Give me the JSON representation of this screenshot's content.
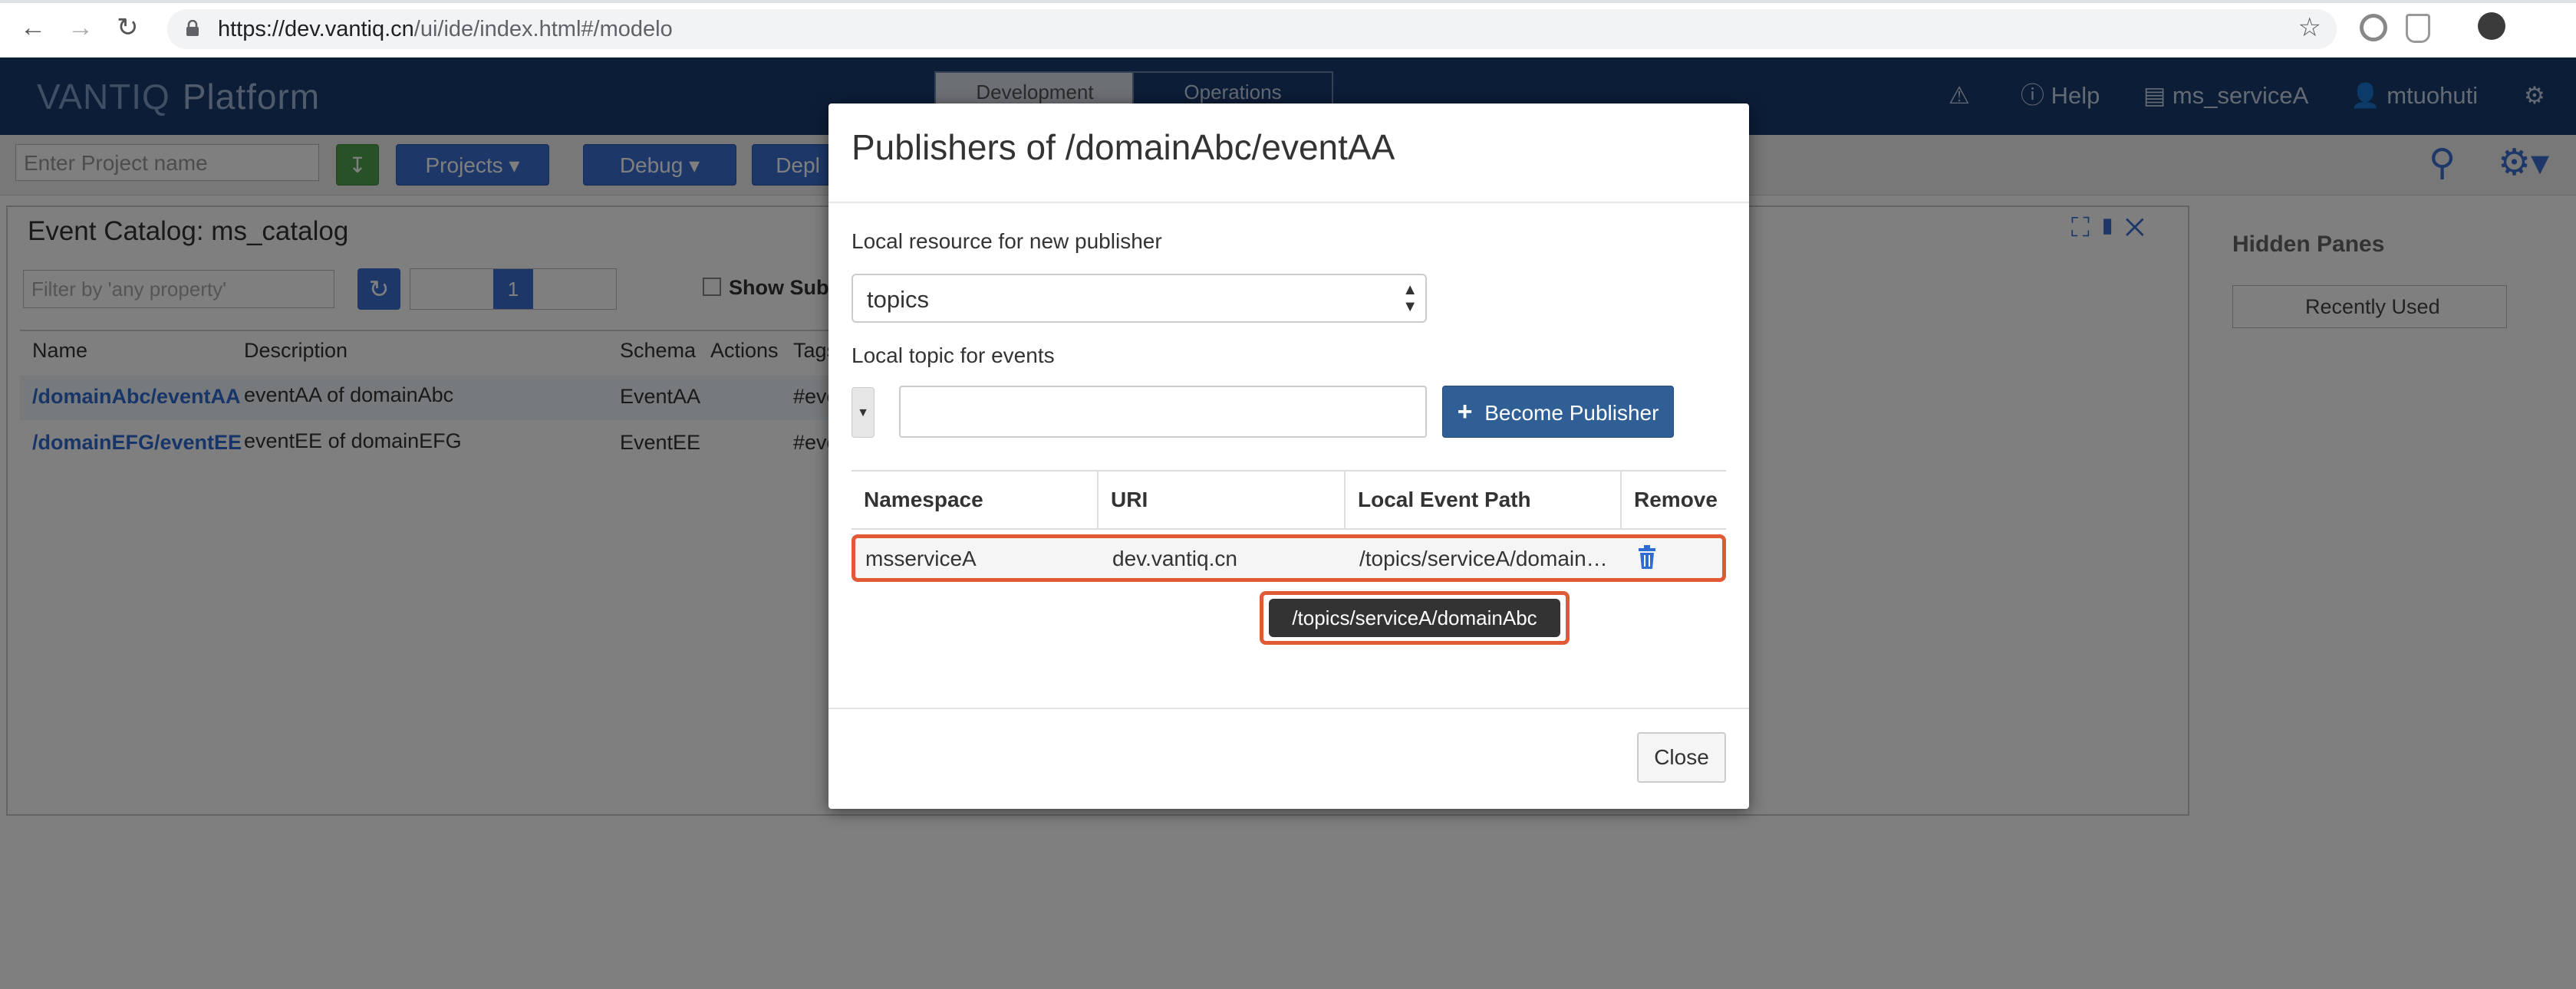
{
  "browser": {
    "url_host": "https://dev.vantiq.cn",
    "url_path": "/ui/ide/index.html#/modelo"
  },
  "app": {
    "logo": "VANTIQ",
    "platform": "Platform",
    "mode_tabs": [
      "Development",
      "Operations"
    ],
    "help": "Help",
    "namespace": "ms_serviceA",
    "user": "mtuohuti"
  },
  "toolbar": {
    "project_placeholder": "Enter Project name",
    "projects": "Projects",
    "debug": "Debug",
    "deploy": "Depl"
  },
  "panel": {
    "title": "Event Catalog: ms_catalog",
    "filter_placeholder": "Filter by 'any property'",
    "page": "1",
    "show_subs": "Show Subs",
    "columns": [
      "Name",
      "Description",
      "Schema",
      "Actions",
      "Tags"
    ],
    "rows": [
      {
        "name": "/domainAbc/eventAA",
        "description": "eventAA of domainAbc",
        "schema": "EventAA",
        "tags": "#eve"
      },
      {
        "name": "/domainEFG/eventEE",
        "description": "eventEE of domainEFG",
        "schema": "EventEE",
        "tags": "#eve"
      }
    ]
  },
  "right_pane": {
    "title": "Hidden Panes",
    "sort": "Recently Used"
  },
  "modal": {
    "title": "Publishers of /domainAbc/eventAA",
    "resource_label": "Local resource for new publisher",
    "resource_value": "topics",
    "topic_label": "Local topic for events",
    "become_publisher": "Become Publisher",
    "columns": [
      "Namespace",
      "URI",
      "Local Event Path",
      "Remove"
    ],
    "row": {
      "namespace": "msserviceA",
      "uri": "dev.vantiq.cn",
      "path": "/topics/serviceA/domain…"
    },
    "tooltip": "/topics/serviceA/domainAbc",
    "close": "Close"
  },
  "colors": {
    "header": "#193a6e",
    "primary_button": "#2f5f95",
    "highlight": "#e05a35"
  }
}
